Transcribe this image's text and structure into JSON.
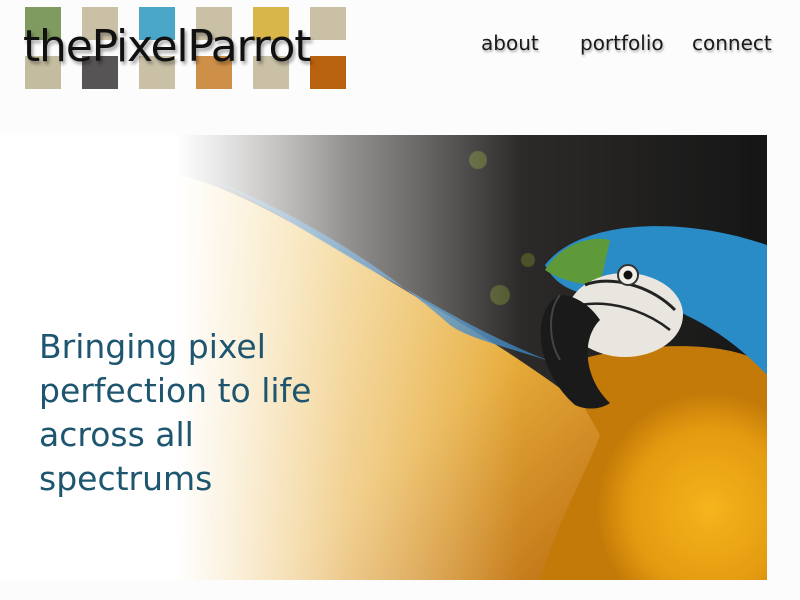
{
  "brand": {
    "name": "thePixelParrot",
    "swatch_colors": [
      "#7f9b60",
      "#c9c0a6",
      "#4aa7c7",
      "#c9c0a6",
      "#d9b64a",
      "#c9c0a6",
      "#c4bc9f",
      "#575455",
      "#c9c0a6",
      "#ce9049",
      "#c9c0a6",
      "#b8620f"
    ]
  },
  "nav": {
    "items": [
      {
        "label": "about"
      },
      {
        "label": "portfolio"
      },
      {
        "label": "connect"
      }
    ]
  },
  "hero": {
    "headline": "Bringing pixel perfection to life across all spectrums",
    "image_subject": "parrot"
  },
  "colors": {
    "headline": "#1e5670",
    "nav_text": "#1a1a1a",
    "page_bg": "#fcfcfc"
  }
}
